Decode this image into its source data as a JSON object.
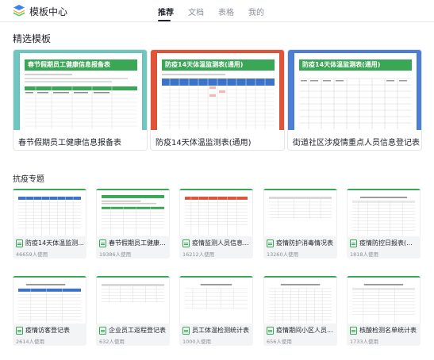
{
  "header": {
    "app_title": "模板中心",
    "tabs": [
      {
        "label": "推荐",
        "active": true
      },
      {
        "label": "文档",
        "active": false
      },
      {
        "label": "表格",
        "active": false
      },
      {
        "label": "我的",
        "active": false
      }
    ]
  },
  "featured": {
    "section_title": "精选模板",
    "items": [
      {
        "caption": "春节假期员工健康信息报备表",
        "banner": "春节假期员工健康信息报备表",
        "bg": "#6fc7c1",
        "banner_color": "#3aa757"
      },
      {
        "caption": "防疫14天体温监测表(通用)",
        "banner": "防疫14天体温监测表(通用)",
        "bg": "#e0553a",
        "banner_color": "#3aa757"
      },
      {
        "caption": "街道社区涉疫情重点人员信息登记表",
        "banner": "防疫14天体温监测表(通用)",
        "bg": "#4d7fd6",
        "banner_color": "#3aa757"
      }
    ]
  },
  "special": {
    "section_title": "抗疫专题",
    "items": [
      {
        "name": "防疫14天体温监测...",
        "usage": "46659人使用"
      },
      {
        "name": "春节假期员工健康...",
        "usage": "19386人使用"
      },
      {
        "name": "疫情监测人员信息...",
        "usage": "16212人使用"
      },
      {
        "name": "疫情防护消毒情况表",
        "usage": "13260人使用"
      },
      {
        "name": "疫情防控日报表(...",
        "usage": "1818人使用"
      },
      {
        "name": "疫情访客登记表",
        "usage": "2614人使用"
      },
      {
        "name": "企业员工返程登记表",
        "usage": "632人使用"
      },
      {
        "name": "员工体温检测统计表",
        "usage": "1000人使用"
      },
      {
        "name": "疫情期间小区人员...",
        "usage": "656人使用"
      },
      {
        "name": "核酸检测名单统计表",
        "usage": "1733人使用"
      }
    ]
  }
}
